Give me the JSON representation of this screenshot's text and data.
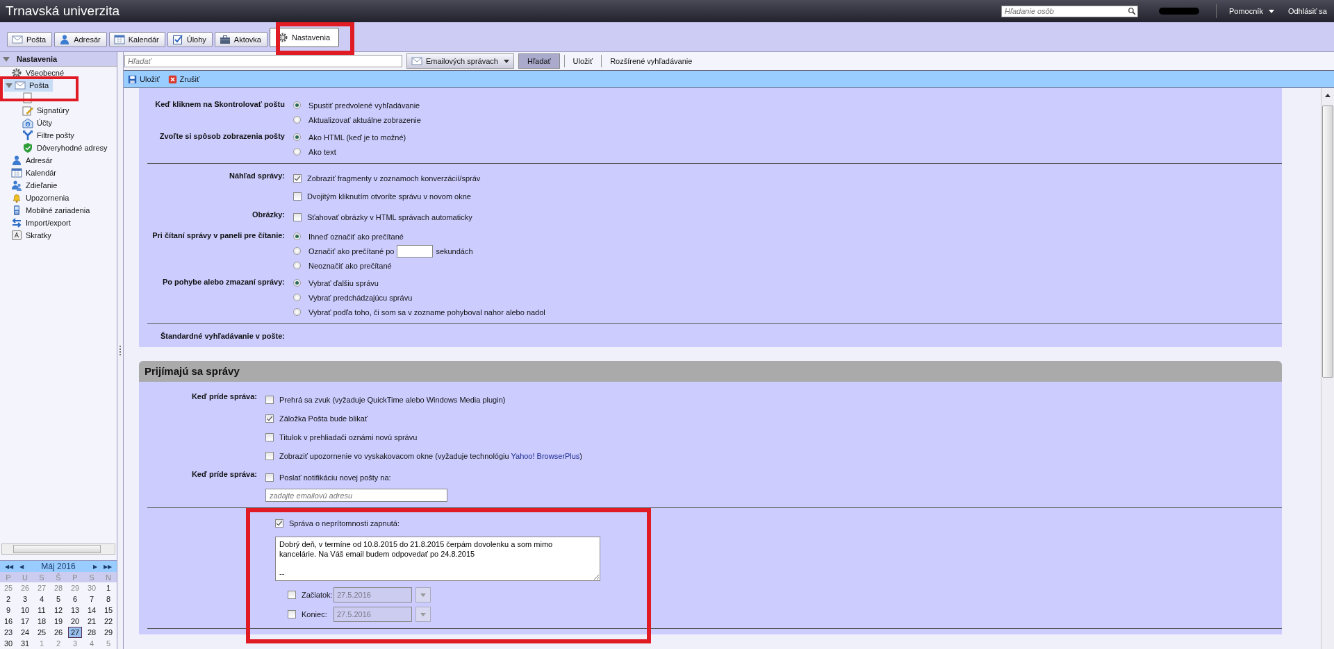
{
  "header": {
    "title": "Trnavská univerzita",
    "people_search": {
      "placeholder": "Hľadanie osôb"
    },
    "links": [
      {
        "text": "Pomocník",
        "dropdown": true
      },
      {
        "text": "Odhlásiť sa",
        "dropdown": false
      }
    ]
  },
  "tabs": [
    {
      "label": "Pošta",
      "kind": "mail",
      "selected": false
    },
    {
      "label": "Adresár",
      "kind": "person",
      "selected": false
    },
    {
      "label": "Kalendár",
      "kind": "calendar",
      "selected": false
    },
    {
      "label": "Úlohy",
      "kind": "task",
      "selected": false
    },
    {
      "label": "Aktovka",
      "kind": "briefcase",
      "selected": false
    },
    {
      "label": "Nastavenia",
      "kind": "gear",
      "selected": true
    }
  ],
  "sidebar": {
    "tree": [
      {
        "label": "Nastavenia",
        "kind": "header",
        "expanded": true,
        "selected": false,
        "children": [
          {
            "label": "Všeobecné",
            "kind": "gear",
            "selected": false
          },
          {
            "label": "Pošta",
            "kind": "mail",
            "selected": true,
            "expanded": true,
            "children": [
              {
                "kind": "document",
                "selected": false
              },
              {
                "label": "Signatúry",
                "kind": "pen",
                "selected": false
              },
              {
                "label": "Účty",
                "kind": "accounts",
                "selected": false
              },
              {
                "label": "Filtre pošty",
                "kind": "filter",
                "selected": false
              },
              {
                "label": "Dôveryhodné adresy",
                "kind": "shield",
                "selected": false
              }
            ]
          },
          {
            "label": "Adresár",
            "kind": "person",
            "selected": false
          },
          {
            "label": "Kalendár",
            "kind": "calendar",
            "selected": false
          },
          {
            "label": "Zdieľanie",
            "kind": "people",
            "selected": false
          },
          {
            "label": "Upozornenia",
            "kind": "bell",
            "selected": false
          },
          {
            "label": "Mobilné zariadenia",
            "kind": "phone",
            "selected": false
          },
          {
            "label": "Import/export",
            "kind": "swap",
            "selected": false
          },
          {
            "label": "Skratky",
            "kind": "key",
            "selected": false
          }
        ]
      }
    ],
    "mini_calendar": {
      "month": "Máj 2016",
      "prev_year": "◀◀",
      "prev_month": "◀",
      "next_month": "▶",
      "next_year": "▶▶",
      "weekdays": [
        "P",
        "U",
        "S",
        "Š",
        "P",
        "S",
        "N"
      ],
      "weeks": [
        [
          {
            "day": "25",
            "other_month": true,
            "selected": false
          },
          {
            "day": "26",
            "other_month": true,
            "selected": false
          },
          {
            "day": "27",
            "other_month": true,
            "selected": false
          },
          {
            "day": "28",
            "other_month": true,
            "selected": false
          },
          {
            "day": "29",
            "other_month": true,
            "selected": false
          },
          {
            "day": "30",
            "other_month": true,
            "selected": false
          },
          {
            "day": "1",
            "other_month": false,
            "selected": false
          }
        ],
        [
          {
            "day": "2",
            "other_month": false,
            "selected": false
          },
          {
            "day": "3",
            "other_month": false,
            "selected": false
          },
          {
            "day": "4",
            "other_month": false,
            "selected": false
          },
          {
            "day": "5",
            "other_month": false,
            "selected": false
          },
          {
            "day": "6",
            "other_month": false,
            "selected": false
          },
          {
            "day": "7",
            "other_month": false,
            "selected": false
          },
          {
            "day": "8",
            "other_month": false,
            "selected": false
          }
        ],
        [
          {
            "day": "9",
            "other_month": false,
            "selected": false
          },
          {
            "day": "10",
            "other_month": false,
            "selected": false
          },
          {
            "day": "11",
            "other_month": false,
            "selected": false
          },
          {
            "day": "12",
            "other_month": false,
            "selected": false
          },
          {
            "day": "13",
            "other_month": false,
            "selected": false
          },
          {
            "day": "14",
            "other_month": false,
            "selected": false
          },
          {
            "day": "15",
            "other_month": false,
            "selected": false
          }
        ],
        [
          {
            "day": "16",
            "other_month": false,
            "selected": false
          },
          {
            "day": "17",
            "other_month": false,
            "selected": false
          },
          {
            "day": "18",
            "other_month": false,
            "selected": false
          },
          {
            "day": "19",
            "other_month": false,
            "selected": false
          },
          {
            "day": "20",
            "other_month": false,
            "selected": false
          },
          {
            "day": "21",
            "other_month": false,
            "selected": false
          },
          {
            "day": "22",
            "other_month": false,
            "selected": false
          }
        ],
        [
          {
            "day": "23",
            "other_month": false,
            "selected": false
          },
          {
            "day": "24",
            "other_month": false,
            "selected": false
          },
          {
            "day": "25",
            "other_month": false,
            "selected": false
          },
          {
            "day": "26",
            "other_month": false,
            "selected": false
          },
          {
            "day": "27",
            "other_month": false,
            "selected": true
          },
          {
            "day": "28",
            "other_month": false,
            "selected": false
          },
          {
            "day": "29",
            "other_month": false,
            "selected": false
          }
        ],
        [
          {
            "day": "30",
            "other_month": false,
            "selected": false
          },
          {
            "day": "31",
            "other_month": false,
            "selected": false
          },
          {
            "day": "1",
            "other_month": true,
            "selected": false
          },
          {
            "day": "2",
            "other_month": true,
            "selected": false
          },
          {
            "day": "3",
            "other_month": true,
            "selected": false
          },
          {
            "day": "4",
            "other_month": true,
            "selected": false
          },
          {
            "day": "5",
            "other_month": true,
            "selected": false
          }
        ]
      ]
    }
  },
  "search_bar": {
    "placeholder": "Hľadať",
    "scope": "Emailových správach",
    "search_button": "Hľadať",
    "save_link": "Uložiť",
    "advanced_link": "Rozšírené vyhľadávanie"
  },
  "toolbar": [
    {
      "label": "Uložiť",
      "kind": "save"
    },
    {
      "label": "Zrušiť",
      "kind": "cancel"
    }
  ],
  "sections": [
    {
      "rows": [
        {
          "kind": "group",
          "label": "Keď kliknem na Skontrolovať poštu",
          "options": [
            {
              "kind": "radio",
              "text": "Spustiť predvolené vyhľadávanie",
              "selected": true
            },
            {
              "kind": "radio",
              "text": "Aktualizovať aktuálne zobrazenie",
              "selected": false
            }
          ]
        },
        {
          "kind": "group",
          "label": "Zvoľte si spôsob zobrazenia pošty",
          "options": [
            {
              "kind": "radio",
              "text": "Ako HTML (keď je to možné)",
              "selected": true
            },
            {
              "kind": "radio",
              "text": "Ako text",
              "selected": false
            }
          ]
        },
        {
          "kind": "divider"
        },
        {
          "kind": "group",
          "label": "Náhľad správy:",
          "options": [
            {
              "kind": "checkbox",
              "text": "Zobraziť fragmenty v zoznamoch konverzácií/správ",
              "checked": true
            },
            {
              "kind": "checkbox",
              "text": "Dvojitým kliknutím otvoríte správu v novom okne",
              "checked": false
            }
          ]
        },
        {
          "kind": "group",
          "label": "Obrázky:",
          "options": [
            {
              "kind": "checkbox",
              "text": "Sťahovať obrázky v HTML správach automaticky",
              "checked": false
            }
          ]
        },
        {
          "kind": "group",
          "label": "Pri čítaní správy v paneli pre čítanie:",
          "options": [
            {
              "kind": "radio",
              "text": "Ihneď označiť ako prečítané",
              "selected": true
            },
            {
              "kind": "radio_field",
              "text": "Označiť ako prečítané po",
              "suffix": "sekundách",
              "selected": false
            },
            {
              "kind": "radio",
              "text": "Neoznačiť ako prečítané",
              "selected": false
            }
          ]
        },
        {
          "kind": "group",
          "label": "Po pohybe alebo zmazaní správy:",
          "options": [
            {
              "kind": "radio",
              "text": "Vybrať ďalšiu správu",
              "selected": true
            },
            {
              "kind": "radio",
              "text": "Vybrať predchádzajúcu správu",
              "selected": false
            },
            {
              "kind": "radio",
              "text": "Vybrať podľa toho, či som sa v zozname pohyboval nahor alebo nadol",
              "selected": false
            }
          ]
        },
        {
          "kind": "divider"
        },
        {
          "kind": "group",
          "label": "Štandardné vyhľadávanie v pošte:",
          "options": []
        }
      ]
    },
    {
      "title": "Prijímajú sa správy",
      "rows": [
        {
          "kind": "group",
          "label": "Keď príde správa:",
          "options": [
            {
              "kind": "checkbox",
              "text": "Prehrá sa zvuk (vyžaduje QuickTime alebo Windows Media plugin)",
              "checked": false
            },
            {
              "kind": "checkbox",
              "text": "Záložka Pošta bude blikať",
              "checked": true
            },
            {
              "kind": "checkbox",
              "text": "Titulok v prehliadači oznámi novú správu",
              "checked": false
            },
            {
              "kind": "checkbox",
              "text": "Zobraziť upozornenie vo vyskakovacom okne (vyžaduje technológiu ",
              "link": "Yahoo! BrowserPlus",
              "text_after": ")",
              "checked": false
            }
          ]
        },
        {
          "kind": "group",
          "label": "Keď príde správa:",
          "options": [
            {
              "kind": "checkbox",
              "text": "Poslať notifikáciu novej pošty na:",
              "checked": false
            },
            {
              "kind": "email_field",
              "placeholder": "zadajte emailovú adresu"
            }
          ]
        },
        {
          "kind": "divider"
        },
        {
          "kind": "group",
          "options": [
            {
              "kind": "checkbox",
              "text": "Správa o neprítomnosti zapnutá:",
              "checked": true
            },
            {
              "kind": "textarea",
              "value": "Dobrý deň, v termíne od 10.8.2015 do 21.8.2015 čerpám dovolenku a som mimo\nkancelárie. Na Váš email budem odpovedať po 24.8.2015\n\n--"
            },
            {
              "kind": "date",
              "text": "Začiatok:",
              "value": "27.5.2016",
              "checked": false
            },
            {
              "kind": "date",
              "text": "Koniec:",
              "value": "27.5.2016",
              "checked": false
            }
          ]
        },
        {
          "kind": "divider"
        }
      ]
    }
  ],
  "highlights": [
    {
      "kind": "tab"
    },
    {
      "kind": "sidebar"
    },
    {
      "kind": "away"
    }
  ]
}
